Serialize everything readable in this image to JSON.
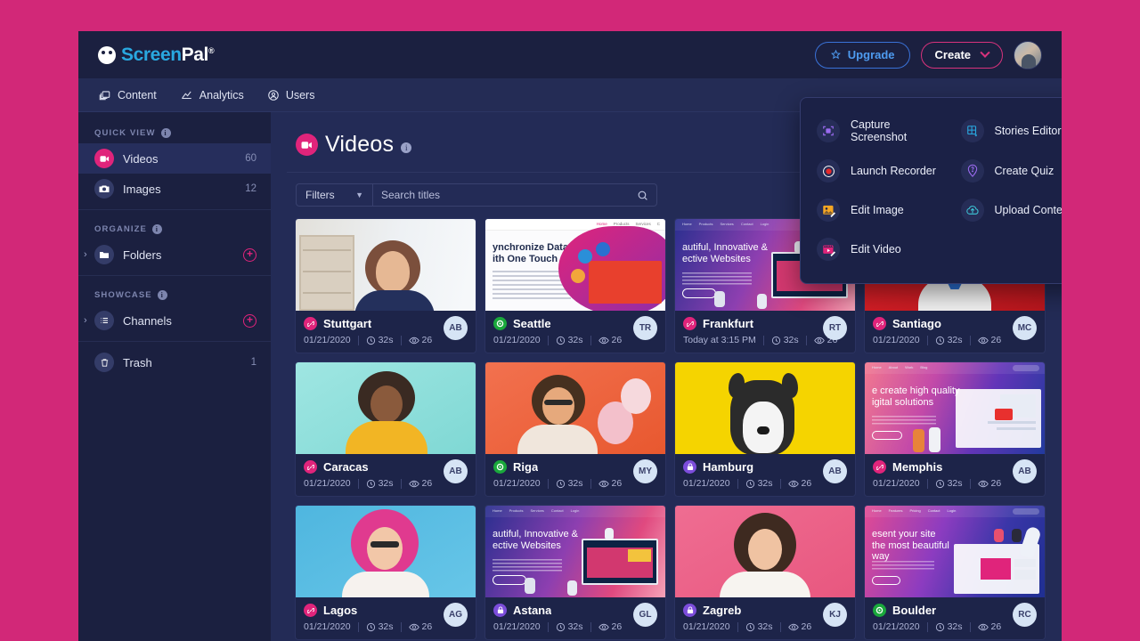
{
  "theme": {
    "page_bg": "#d22878",
    "topbar_bg": "#1b2040",
    "sidebar_bg": "#1b2040",
    "content_bg": "#232b56",
    "accent_pink": "#e0247b",
    "accent_blue": "#4e9bf0",
    "public_green": "#1aa83c",
    "private_purple": "#7c4ddb"
  },
  "topbar": {
    "logo_screen": "Screen",
    "logo_pal": "Pal",
    "logo_reg": "®",
    "upgrade_label": "Upgrade",
    "create_label": "Create"
  },
  "nav": {
    "items": [
      {
        "label": "Content",
        "icon": "content-icon"
      },
      {
        "label": "Analytics",
        "icon": "analytics-icon"
      },
      {
        "label": "Users",
        "icon": "users-icon"
      }
    ]
  },
  "create_menu": {
    "items": [
      {
        "label": "Capture Screenshot",
        "icon": "capture-screenshot-icon"
      },
      {
        "label": "Stories Editor",
        "icon": "stories-editor-icon"
      },
      {
        "label": "Launch Recorder",
        "icon": "launch-recorder-icon"
      },
      {
        "label": "Create Quiz",
        "icon": "create-quiz-icon"
      },
      {
        "label": "Edit Image",
        "icon": "edit-image-icon"
      },
      {
        "label": "Upload Content",
        "icon": "upload-content-icon"
      },
      {
        "label": "Edit Video",
        "icon": "edit-video-icon"
      }
    ]
  },
  "sidebar": {
    "quick_view_label": "QUICK VIEW",
    "organize_label": "ORGANIZE",
    "showcase_label": "SHOWCASE",
    "quick_view": [
      {
        "label": "Videos",
        "count": "60",
        "icon": "video-camera-icon",
        "active": true
      },
      {
        "label": "Images",
        "count": "12",
        "icon": "camera-icon",
        "active": false
      }
    ],
    "organize": [
      {
        "label": "Folders",
        "icon": "folder-icon",
        "add": "+"
      }
    ],
    "showcase": [
      {
        "label": "Channels",
        "icon": "list-icon",
        "add": "+"
      }
    ],
    "trash": {
      "label": "Trash",
      "count": "1",
      "icon": "trash-icon"
    }
  },
  "main": {
    "title": "Videos",
    "filters_label": "Filters",
    "search_placeholder": "Search titles",
    "search_value": ""
  },
  "cards": [
    {
      "title": "Stuttgart",
      "date": "01/21/2020",
      "duration": "32s",
      "views": "26",
      "initials": "AB",
      "visibility": "link",
      "thumb": "portrait-woman-shelf"
    },
    {
      "title": "Seattle",
      "date": "01/21/2020",
      "duration": "32s",
      "views": "26",
      "initials": "TR",
      "visibility": "public",
      "thumb": "web-synchronize-data",
      "head1": "ynchronize Data",
      "head2": "ith One Touch"
    },
    {
      "title": "Frankfurt",
      "date": "Today at 3:15 PM",
      "duration": "32s",
      "views": "26",
      "initials": "RT",
      "visibility": "link",
      "thumb": "web-beautiful-innovative",
      "head1": "autiful, Innovative &",
      "head2": "ective Websites"
    },
    {
      "title": "Santiago",
      "date": "01/21/2020",
      "duration": "32s",
      "views": "26",
      "initials": "MC",
      "visibility": "link",
      "thumb": "portrait-man-red"
    },
    {
      "title": "Caracas",
      "date": "01/21/2020",
      "duration": "32s",
      "views": "26",
      "initials": "AB",
      "visibility": "link",
      "thumb": "portrait-woman-teal"
    },
    {
      "title": "Riga",
      "date": "01/21/2020",
      "duration": "32s",
      "views": "26",
      "initials": "MY",
      "visibility": "public",
      "thumb": "portrait-woman-balloons"
    },
    {
      "title": "Hamburg",
      "date": "01/21/2020",
      "duration": "32s",
      "views": "26",
      "initials": "AB",
      "visibility": "private",
      "thumb": "dog-yellow"
    },
    {
      "title": "Memphis",
      "date": "01/21/2020",
      "duration": "32s",
      "views": "26",
      "initials": "AB",
      "visibility": "link",
      "thumb": "web-high-quality",
      "head1": "e create high quality",
      "head2": "igital solutions"
    },
    {
      "title": "Lagos",
      "date": "01/21/2020",
      "duration": "32s",
      "views": "26",
      "initials": "AG",
      "visibility": "link",
      "thumb": "portrait-pink-hair"
    },
    {
      "title": "Astana",
      "date": "01/21/2020",
      "duration": "32s",
      "views": "26",
      "initials": "GL",
      "visibility": "private",
      "thumb": "web-beautiful-innovative2",
      "head1": "autiful, Innovative &",
      "head2": "ective Websites"
    },
    {
      "title": "Zagreb",
      "date": "01/21/2020",
      "duration": "32s",
      "views": "26",
      "initials": "KJ",
      "visibility": "private",
      "thumb": "portrait-woman-pink"
    },
    {
      "title": "Boulder",
      "date": "01/21/2020",
      "duration": "32s",
      "views": "26",
      "initials": "RC",
      "visibility": "public",
      "thumb": "web-present-your-site",
      "head1": "esent your site",
      "head2": "the most beautiful way"
    }
  ]
}
